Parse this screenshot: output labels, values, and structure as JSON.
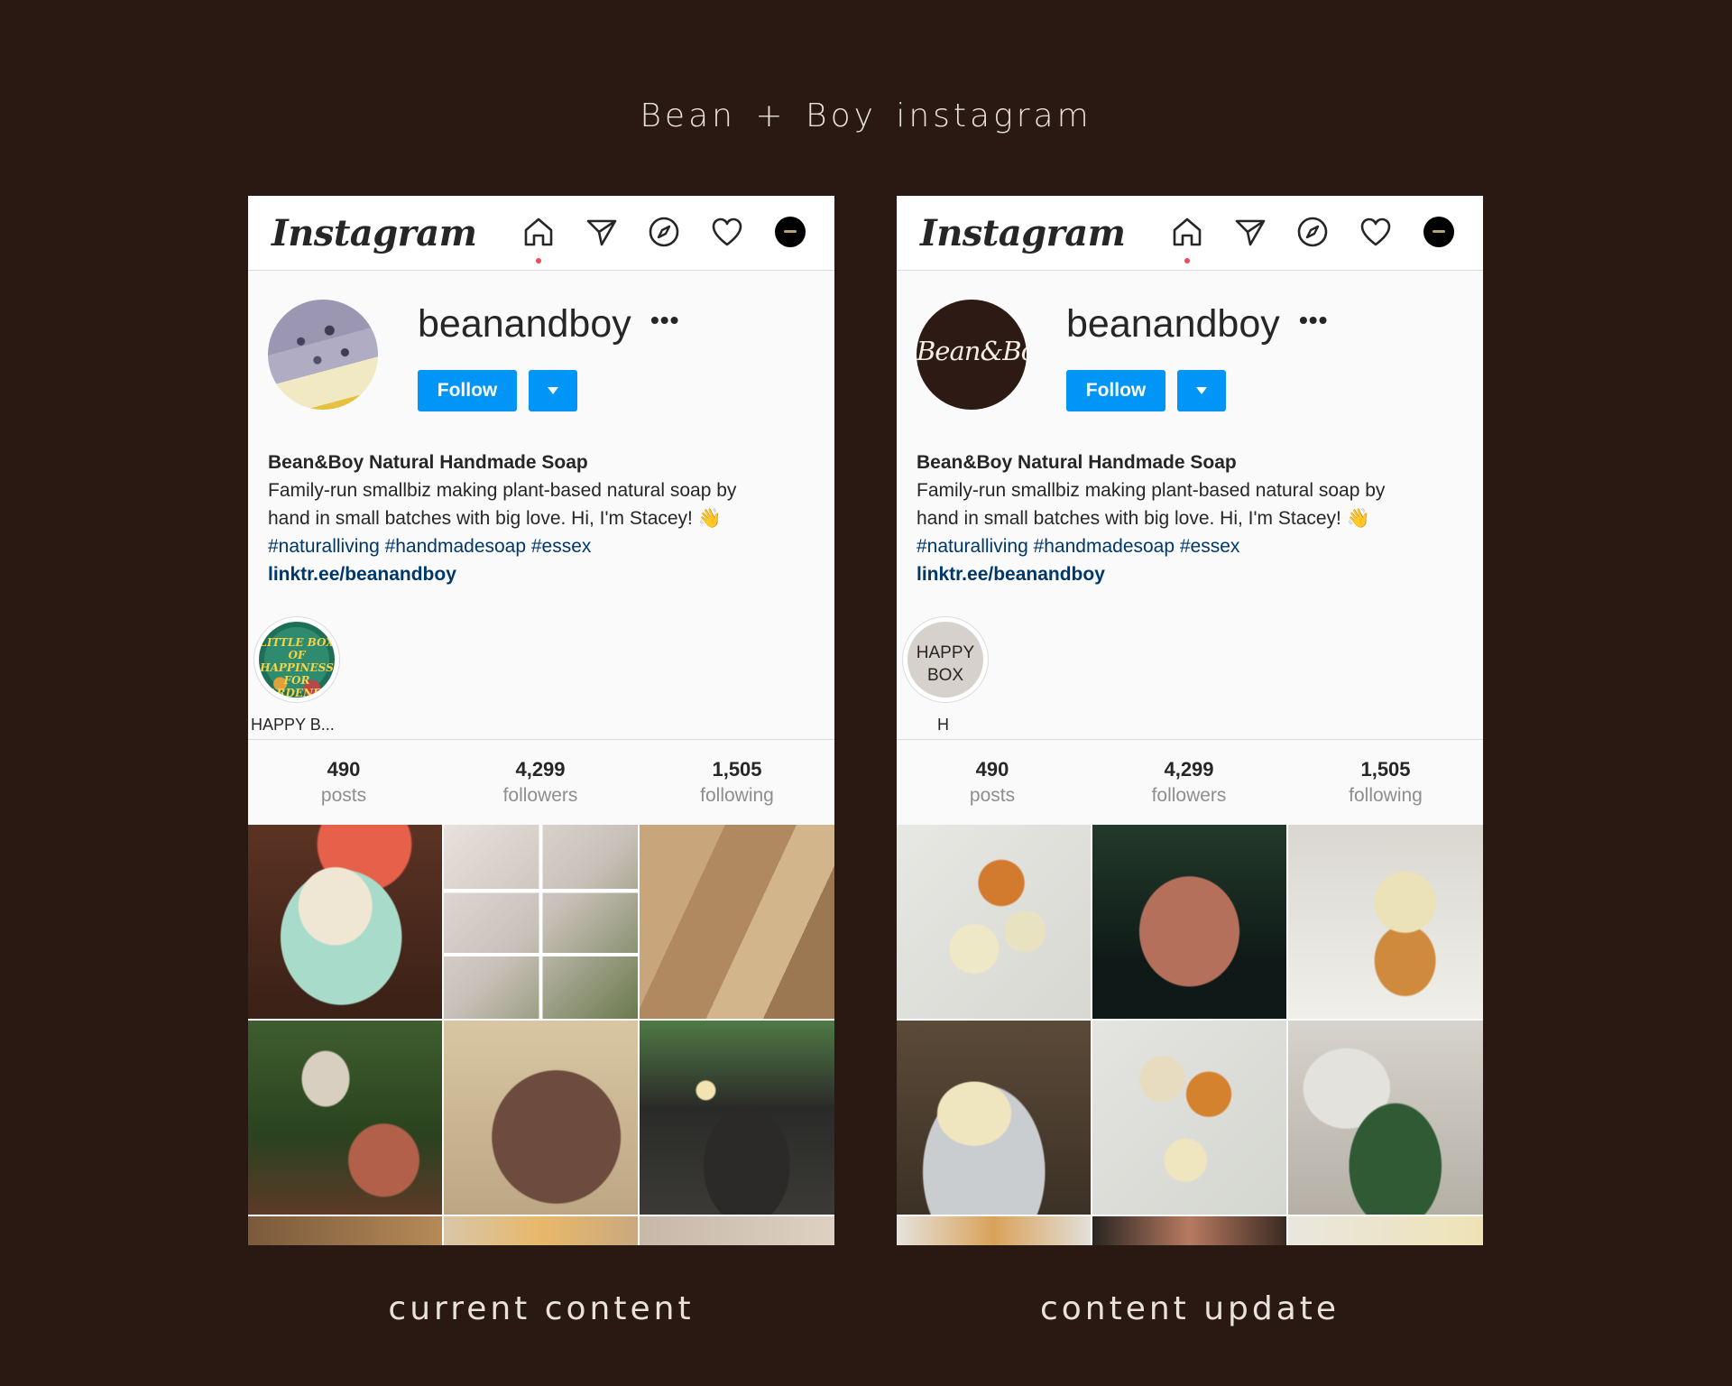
{
  "title": "Bean + Boy  instagram",
  "captions": {
    "left": "current content",
    "right": "content update"
  },
  "colors": {
    "background": "#2a1913",
    "follow_button": "#0095f6",
    "link": "#00376b",
    "notification_dot": "#ed4956"
  },
  "phones": [
    {
      "header": {
        "logo": "Instagram",
        "nav_icons": [
          "home-icon",
          "direct-icon",
          "explore-icon",
          "heart-icon",
          "profile-avatar"
        ]
      },
      "profile": {
        "username": "beanandboy",
        "more": "•••",
        "follow_label": "Follow",
        "bio_name": "Bean&Boy Natural Handmade Soap",
        "bio_line1": "Family-run smallbiz making plant-based natural soap by",
        "bio_line2": "hand in small batches with big love. Hi, I'm Stacey! 👋",
        "bio_tags": "#naturalliving #handmadesoap #essex",
        "bio_link": "linktr.ee/beanandboy"
      },
      "highlight": {
        "image_text": "LITTLE BOX OF HAPPINESS FOR GARDENERS",
        "label": "HAPPY B..."
      },
      "stats": [
        {
          "value": "490",
          "label": "posts"
        },
        {
          "value": "4,299",
          "label": "followers"
        },
        {
          "value": "1,505",
          "label": "following"
        }
      ]
    },
    {
      "header": {
        "logo": "Instagram",
        "nav_icons": [
          "home-icon",
          "direct-icon",
          "explore-icon",
          "heart-icon",
          "profile-avatar"
        ]
      },
      "profile": {
        "username": "beanandboy",
        "more": "•••",
        "follow_label": "Follow",
        "avatar_logo": "Bean&Boy",
        "bio_name": "Bean&Boy Natural Handmade Soap",
        "bio_line1": "Family-run smallbiz making plant-based natural soap by",
        "bio_line2": "hand in small batches with big love. Hi, I'm Stacey! 👋",
        "bio_tags": "#naturalliving #handmadesoap #essex",
        "bio_link": "linktr.ee/beanandboy"
      },
      "highlight": {
        "image_text_line1": "HAPPY",
        "image_text_line2": "BOX",
        "label": "H"
      },
      "stats": [
        {
          "value": "490",
          "label": "posts"
        },
        {
          "value": "4,299",
          "label": "followers"
        },
        {
          "value": "1,505",
          "label": "following"
        }
      ]
    }
  ]
}
